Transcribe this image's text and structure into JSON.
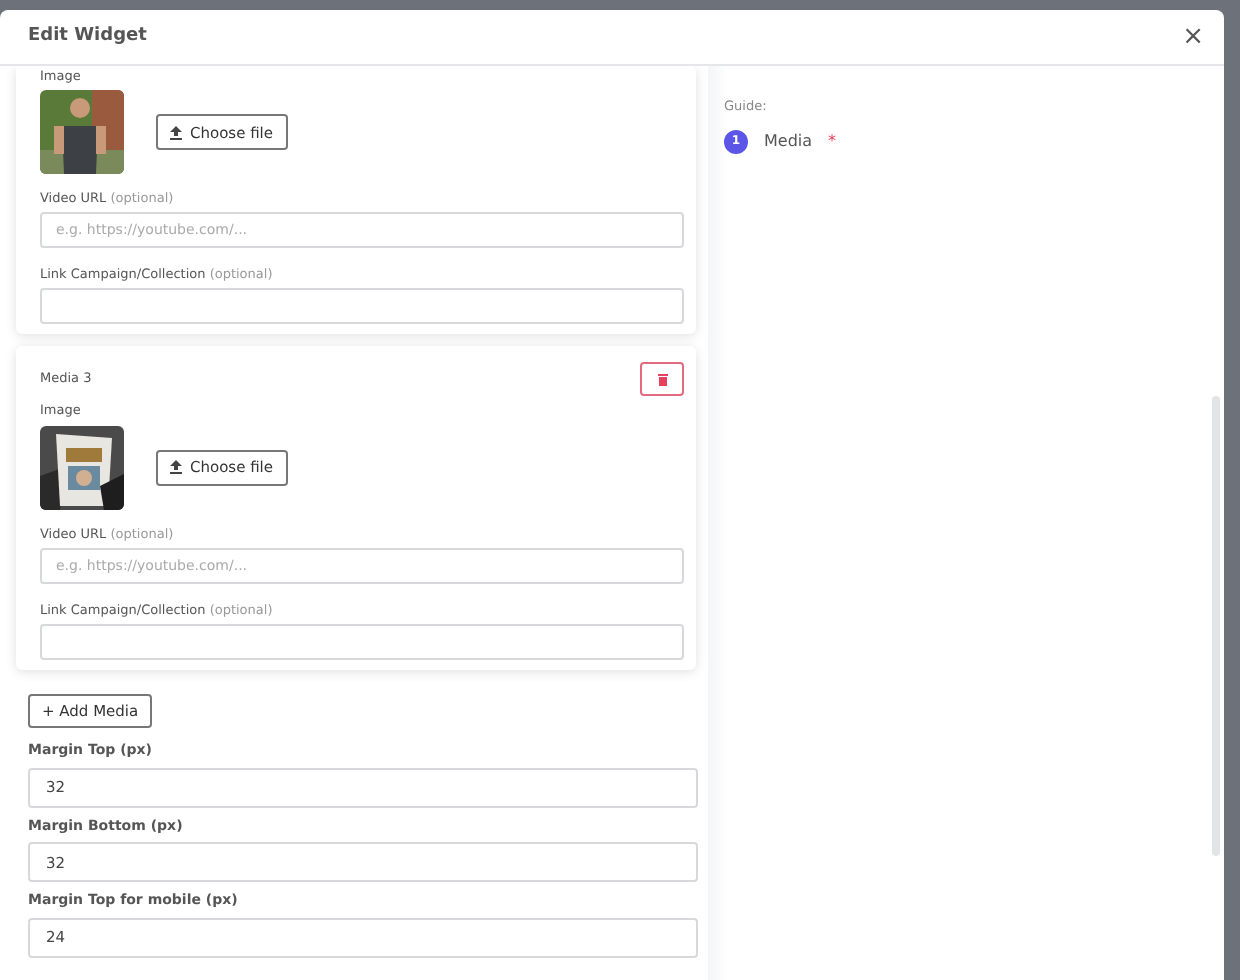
{
  "modal": {
    "title": "Edit Widget",
    "close": "×"
  },
  "media": [
    {
      "image_label": "Image",
      "choose_file": "Choose file",
      "video_label": "Video URL",
      "video_hint": "(optional)",
      "video_placeholder": "e.g. https://youtube.com/...",
      "link_label": "Link Campaign/Collection",
      "link_hint": "(optional)"
    },
    {
      "heading": "Media 3",
      "image_label": "Image",
      "choose_file": "Choose file",
      "video_label": "Video URL",
      "video_hint": "(optional)",
      "video_placeholder": "e.g. https://youtube.com/...",
      "link_label": "Link Campaign/Collection",
      "link_hint": "(optional)"
    }
  ],
  "add_button": "+ Add Media",
  "settings": [
    {
      "label": "Margin Top (px)",
      "value": "32"
    },
    {
      "label": "Margin Bottom (px)",
      "value": "32"
    },
    {
      "label": "Margin Top for mobile (px)",
      "value": "24"
    }
  ],
  "guide": {
    "title": "Guide:",
    "steps": [
      {
        "number": "1",
        "label": "Media",
        "required_mark": "*"
      }
    ]
  }
}
